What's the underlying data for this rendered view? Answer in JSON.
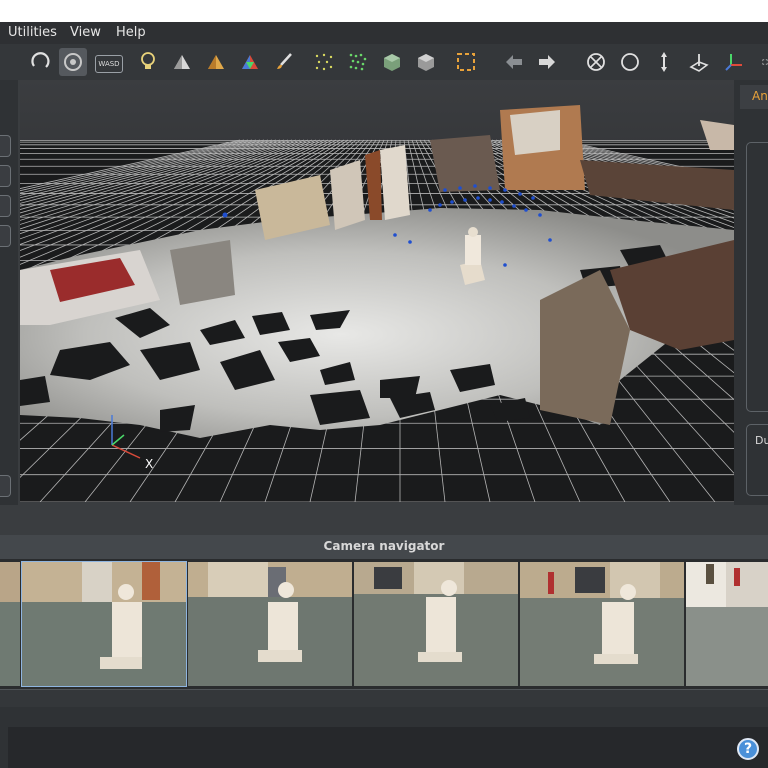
{
  "menu": {
    "items": [
      "Utilities",
      "View",
      "Help"
    ]
  },
  "toolbar": {
    "wasd_label": "WASD",
    "icons": [
      "rotate-icon",
      "orbit-icon",
      "wasd-icon",
      "lightbulb-icon",
      "shading-flat-icon",
      "shading-vertex-icon",
      "shading-texture-icon",
      "paint-brush-icon",
      "point-cloud-icon",
      "dense-cloud-icon",
      "mesh-icon",
      "textured-mesh-icon",
      "selection-box-icon",
      "undo-icon",
      "redo-icon",
      "gizmo-icon",
      "circle-icon",
      "vertical-axis-icon",
      "ground-plane-icon",
      "axes-icon"
    ]
  },
  "viewport": {
    "axis_label": "X"
  },
  "right_panel": {
    "tab_label": "An",
    "label_du": "Du"
  },
  "camera_navigator": {
    "title": "Camera navigator"
  },
  "help": {
    "label": "?"
  },
  "colors": {
    "accent": "#e8a23a",
    "point_blue": "#1f4fd0",
    "grid": "#d0d0d0"
  }
}
